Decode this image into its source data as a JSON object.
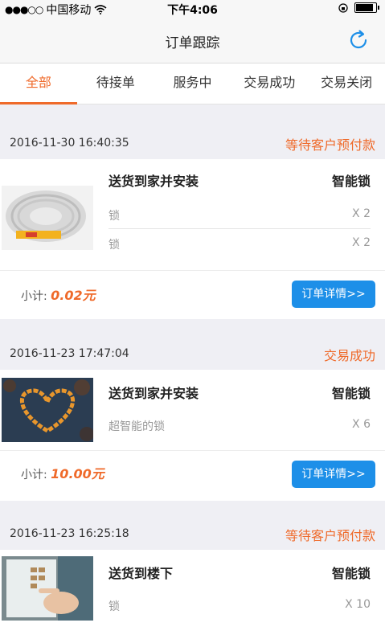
{
  "status_bar": {
    "carrier": "中国移动",
    "time": "下午4:06"
  },
  "nav": {
    "title": "订单跟踪"
  },
  "tabs": [
    "全部",
    "待接单",
    "服务中",
    "交易成功",
    "交易关闭"
  ],
  "orders": [
    {
      "date": "2016-11-30 16:40:35",
      "status": "等待客户预付款",
      "title": "送货到家并安装",
      "brand": "智能锁",
      "lines": [
        {
          "name": "锁",
          "qty": "X 2"
        },
        {
          "name": "锁",
          "qty": "X 2"
        }
      ],
      "subtotal_label": "小计:",
      "subtotal_amount": "0.02元",
      "detail_label": "订单详情>>"
    },
    {
      "date": "2016-11-23 17:47:04",
      "status": "交易成功",
      "title": "送货到家并安装",
      "brand": "智能锁",
      "lines": [
        {
          "name": "超智能的锁",
          "qty": "X 6"
        }
      ],
      "subtotal_label": "小计:",
      "subtotal_amount": "10.00元",
      "detail_label": "订单详情>>"
    },
    {
      "date": "2016-11-23 16:25:18",
      "status": "等待客户预付款",
      "title": "送货到楼下",
      "brand": "智能锁",
      "lines": [
        {
          "name": "锁",
          "qty": "X 10"
        }
      ]
    }
  ],
  "colors": {
    "accent": "#ef6a2a",
    "button": "#1d8fe8",
    "background": "#efeff4"
  },
  "icons": {
    "refresh": "refresh-icon",
    "wifi": "wifi-icon",
    "battery": "battery-icon"
  }
}
